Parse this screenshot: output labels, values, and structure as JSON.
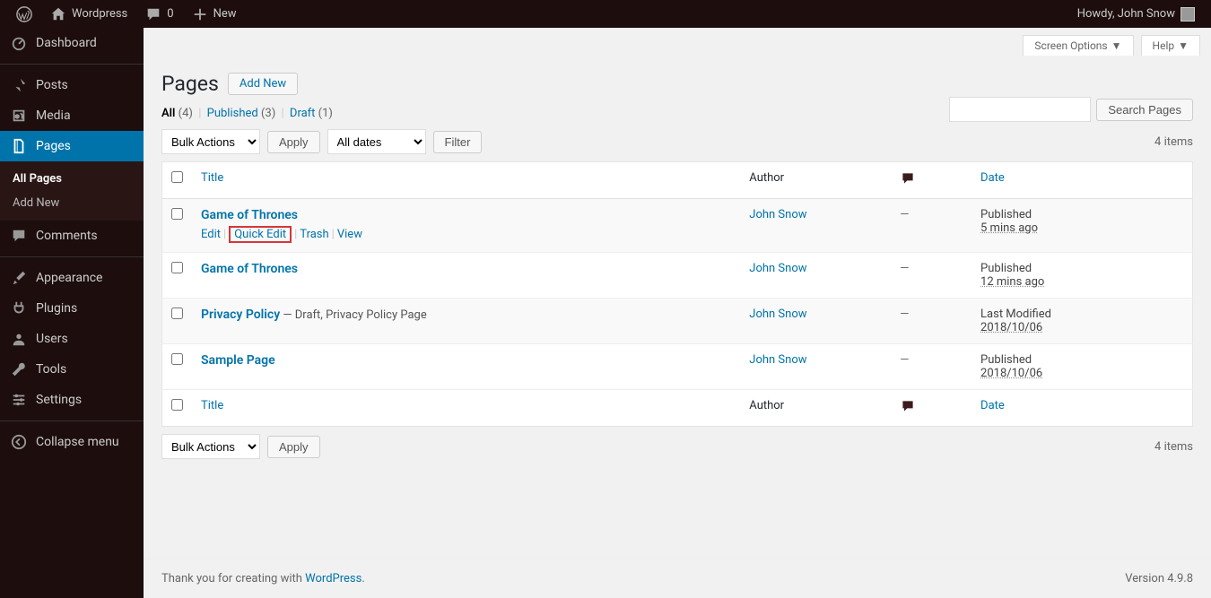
{
  "adminbar": {
    "site_name": "Wordpress",
    "comment_count": "0",
    "new_label": "New",
    "greeting": "Howdy, John Snow"
  },
  "sidebar": {
    "items": [
      {
        "label": "Dashboard"
      },
      {
        "label": "Posts"
      },
      {
        "label": "Media"
      },
      {
        "label": "Pages",
        "active": true
      },
      {
        "label": "Comments"
      },
      {
        "label": "Appearance"
      },
      {
        "label": "Plugins"
      },
      {
        "label": "Users"
      },
      {
        "label": "Tools"
      },
      {
        "label": "Settings"
      }
    ],
    "sub": {
      "all": "All Pages",
      "add": "Add New"
    },
    "collapse": "Collapse menu"
  },
  "screen": {
    "options": "Screen Options",
    "help": "Help"
  },
  "page": {
    "title": "Pages",
    "add_new": "Add New"
  },
  "filters": {
    "all_label": "All",
    "all_count": "(4)",
    "published_label": "Published",
    "published_count": "(3)",
    "draft_label": "Draft",
    "draft_count": "(1)"
  },
  "search": {
    "button": "Search Pages"
  },
  "bulk": {
    "label": "Bulk Actions",
    "apply": "Apply",
    "dates": "All dates",
    "filter": "Filter"
  },
  "items_count": "4 items",
  "columns": {
    "title": "Title",
    "author": "Author",
    "date": "Date"
  },
  "rows": [
    {
      "title": "Game of Thrones",
      "state": "",
      "author": "John Snow",
      "date_label": "Published",
      "date_value": "5 mins ago",
      "show_actions": true
    },
    {
      "title": "Game of Thrones",
      "state": "",
      "author": "John Snow",
      "date_label": "Published",
      "date_value": "12 mins ago",
      "show_actions": false
    },
    {
      "title": "Privacy Policy",
      "state": " — Draft, Privacy Policy Page",
      "author": "John Snow",
      "date_label": "Last Modified",
      "date_value": "2018/10/06",
      "show_actions": false
    },
    {
      "title": "Sample Page",
      "state": "",
      "author": "John Snow",
      "date_label": "Published",
      "date_value": "2018/10/06",
      "show_actions": false
    }
  ],
  "row_actions": {
    "edit": "Edit",
    "quick_edit": "Quick Edit",
    "trash": "Trash",
    "view": "View"
  },
  "footer": {
    "thank1": "Thank you for creating with ",
    "thank2": "WordPress",
    "thank3": ".",
    "version": "Version 4.9.8"
  }
}
